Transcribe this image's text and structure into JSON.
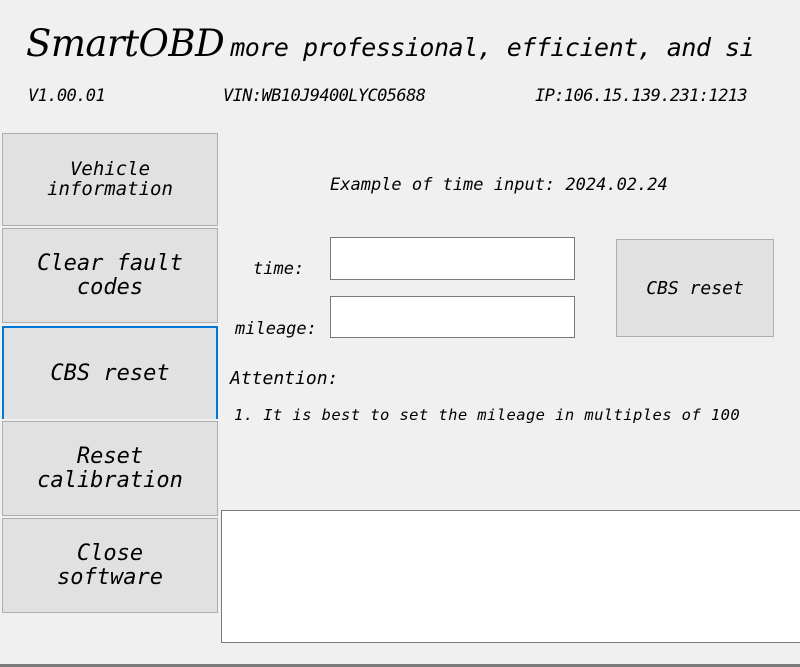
{
  "header": {
    "title": "SmartOBD",
    "tagline": "more professional, efficient, and si",
    "version": "V1.00.01",
    "vin": "VIN:WB10J9400LYC05688",
    "ip": "IP:106.15.139.231:1213"
  },
  "sidebar": {
    "items": [
      {
        "line1": "Vehicle",
        "line2": "information"
      },
      {
        "line1": "Clear fault",
        "line2": "codes"
      },
      {
        "line1": "CBS reset",
        "line2": ""
      },
      {
        "line1": "Reset",
        "line2": "calibration"
      },
      {
        "line1": "Close",
        "line2": "software"
      }
    ],
    "active_index": 2,
    "active_color": "#0078d7"
  },
  "main": {
    "example_text": "Example of time input:  2024.02.24",
    "time_label": "time:",
    "time_value": "",
    "mileage_label": "mileage:",
    "mileage_value": "",
    "cbs_button_label": "CBS reset",
    "attention_label": "Attention:",
    "attention_note": "1. It is best to set the mileage in multiples of 100",
    "output_text": ""
  }
}
